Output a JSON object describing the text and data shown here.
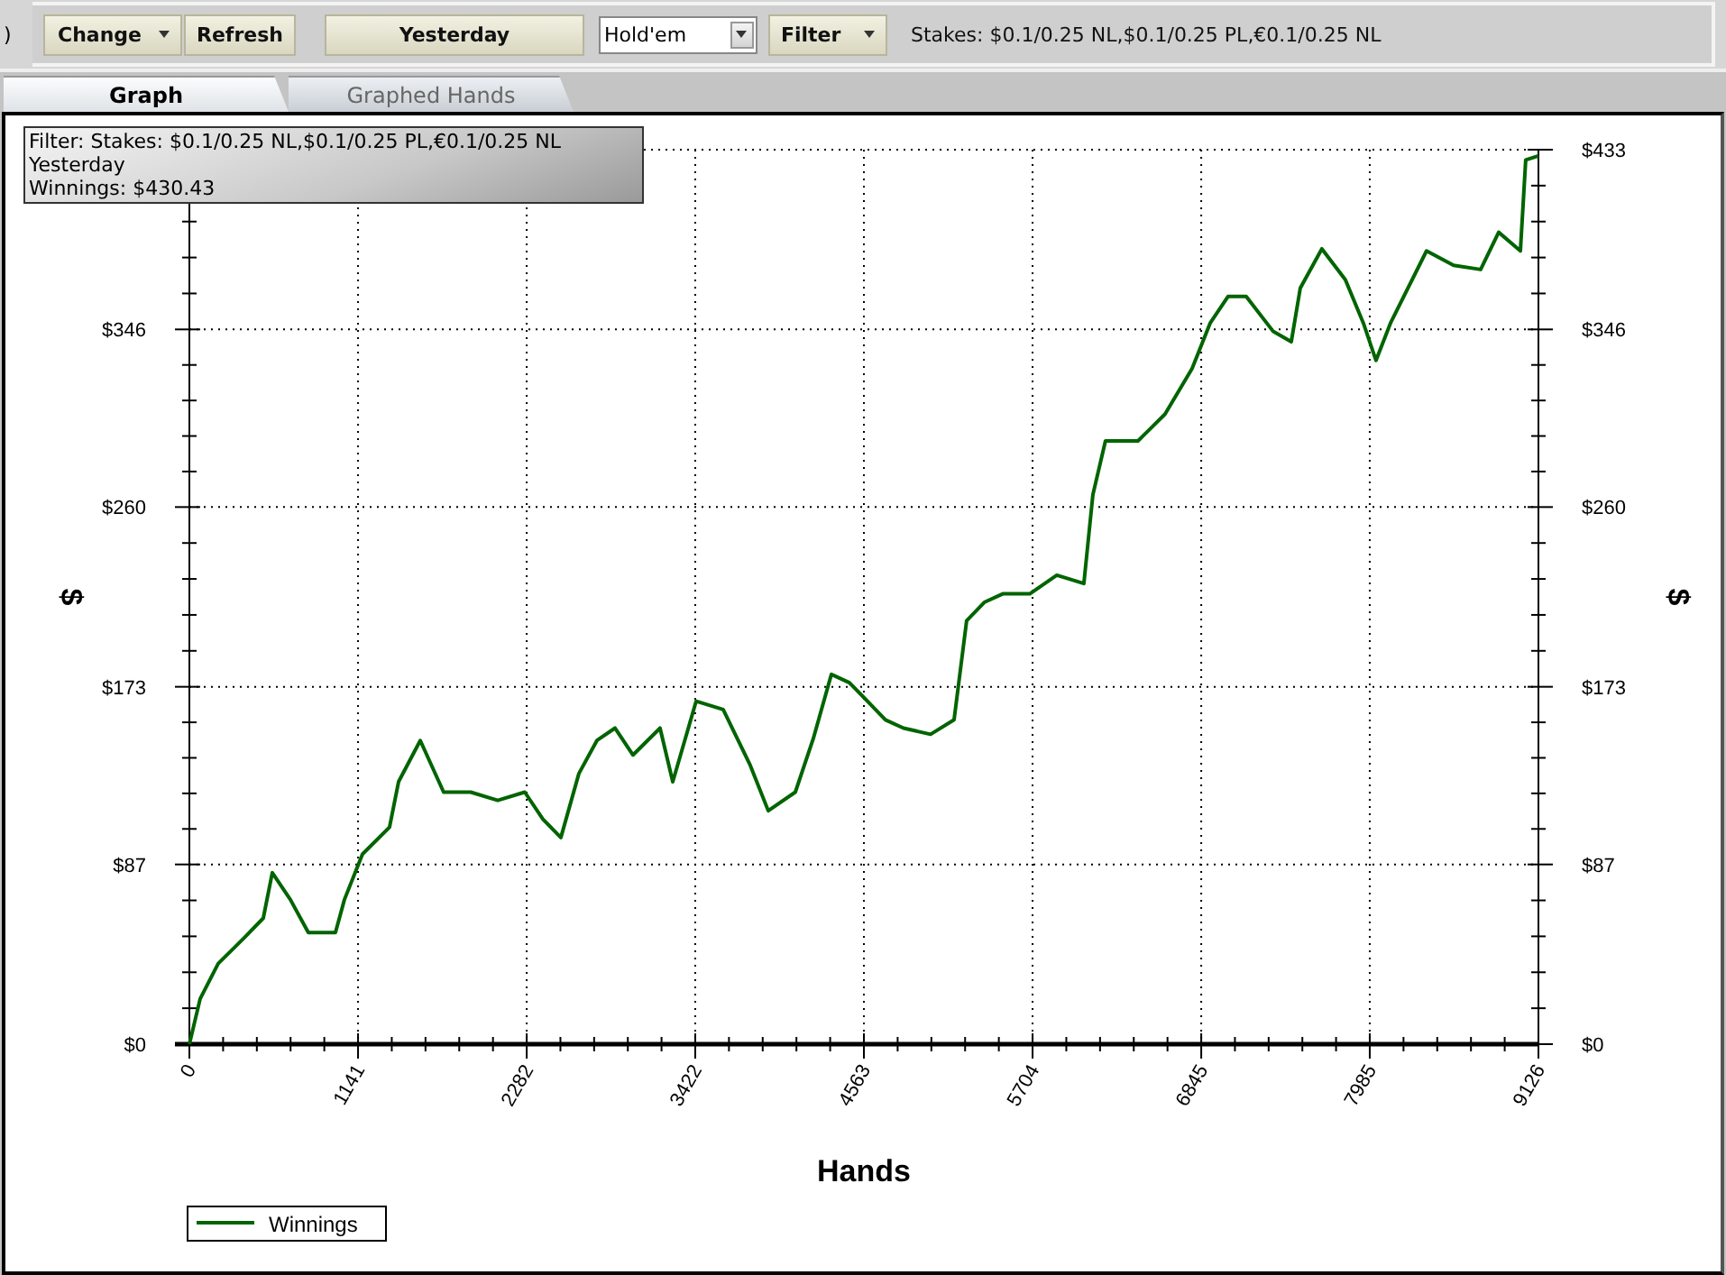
{
  "toolbar": {
    "cut_text": ")",
    "buttons": [
      {
        "label": "Change",
        "kind": "dropdown"
      },
      {
        "label": "Refresh",
        "kind": "plain"
      }
    ],
    "date_button": "Yesterday",
    "game_select": {
      "value": "Hold'em"
    },
    "filter_button": "Filter",
    "filter_summary": "Stakes: $0.1/0.25 NL,$0.1/0.25 PL,€0.1/0.25 NL"
  },
  "tabs": [
    {
      "label": "Graph",
      "selected": true
    },
    {
      "label": "Graphed Hands",
      "selected": false
    }
  ],
  "info_box": {
    "lines": [
      "Filter: Stakes: $0.1/0.25 NL,$0.1/0.25 PL,€0.1/0.25 NL",
      "Yesterday",
      "Winnings: $430.43"
    ]
  },
  "chart_data": {
    "type": "line",
    "grid": true,
    "xlabel": "Hands",
    "ylabel": "$",
    "xlim": [
      0,
      9126
    ],
    "ylim": [
      0,
      433
    ],
    "xticks": [
      0,
      1141,
      2282,
      3422,
      4563,
      5704,
      6845,
      7985,
      9126
    ],
    "yticks": [
      {
        "value": 0,
        "label": "$0"
      },
      {
        "value": 87,
        "label": "$87"
      },
      {
        "value": 173,
        "label": "$173"
      },
      {
        "value": 260,
        "label": "$260"
      },
      {
        "value": 346,
        "label": "$346"
      },
      {
        "value": 433,
        "label": "$433"
      }
    ],
    "x": [
      0,
      73,
      195,
      378,
      500,
      561,
      683,
      805,
      988,
      1049,
      1171,
      1354,
      1415,
      1562,
      1720,
      1903,
      2086,
      2269,
      2391,
      2513,
      2635,
      2757,
      2879,
      3001,
      3184,
      3270,
      3428,
      3611,
      3794,
      3916,
      4099,
      4221,
      4343,
      4465,
      4587,
      4709,
      4831,
      5014,
      5173,
      5258,
      5380,
      5502,
      5685,
      5868,
      6051,
      6112,
      6197,
      6417,
      6600,
      6783,
      6905,
      7027,
      7149,
      7332,
      7454,
      7515,
      7661,
      7820,
      7942,
      8027,
      8125,
      8369,
      8552,
      8735,
      8857,
      9004,
      9040,
      9126
    ],
    "series": [
      {
        "name": "Winnings",
        "color": "#006400",
        "values": [
          0,
          22,
          39,
          52,
          61,
          83,
          70,
          54,
          54,
          70,
          92,
          105,
          127,
          147,
          122,
          122,
          118,
          122,
          109,
          100,
          131,
          147,
          153,
          140,
          153,
          127,
          166,
          162,
          135,
          113,
          122,
          148,
          179,
          175,
          166,
          157,
          153,
          150,
          157,
          205,
          214,
          218,
          218,
          227,
          223,
          266,
          292,
          292,
          305,
          327,
          349,
          362,
          362,
          345,
          340,
          366,
          385,
          370,
          349,
          331,
          349,
          384,
          377,
          375,
          393,
          384,
          428,
          430
        ]
      }
    ]
  }
}
